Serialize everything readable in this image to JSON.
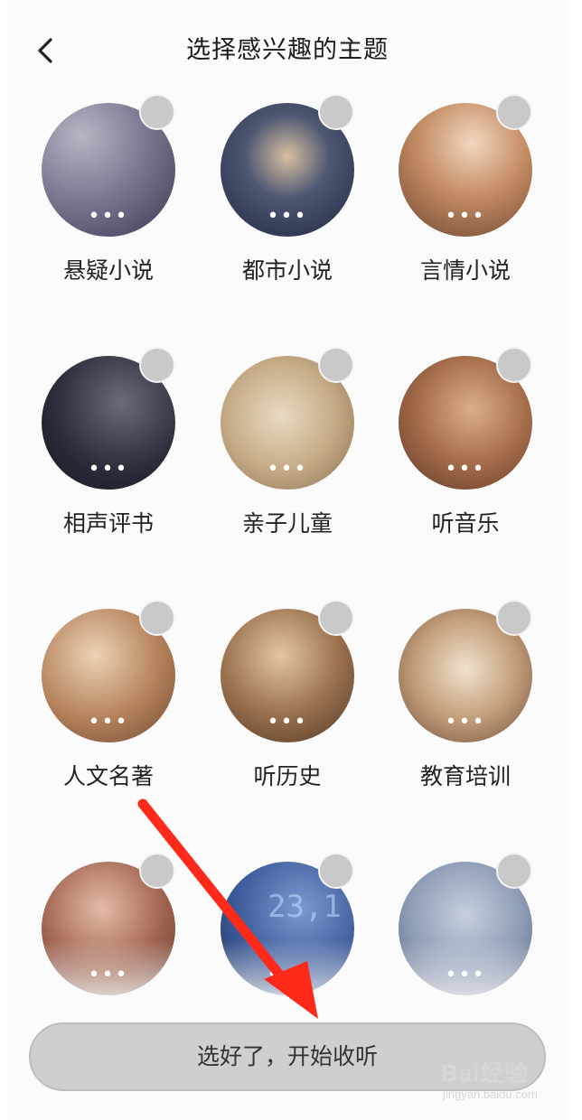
{
  "header": {
    "title": "选择感兴趣的主题",
    "back_icon": "chevron-left-icon"
  },
  "topics": [
    {
      "label": "悬疑小说",
      "more": "•••",
      "bg": "radial-gradient(circle at 30% 25%, #b7b4c4 0%, #7d7a93 45%, #3b3a52 100%)"
    },
    {
      "label": "都市小说",
      "more": "•••",
      "bg": "radial-gradient(circle at 50% 40%, #d8c0a0 0%, #4f5873 40%, #1f2640 100%)"
    },
    {
      "label": "言情小说",
      "more": "•••",
      "bg": "radial-gradient(circle at 55% 30%, #f2d7c0 0%, #c48c63 45%, #6b4530 100%)"
    },
    {
      "label": "相声评书",
      "more": "•••",
      "bg": "radial-gradient(circle at 60% 35%, #6a6d78 0%, #2c2f3c 55%, #14161f 100%)"
    },
    {
      "label": "亲子儿童",
      "more": "•••",
      "bg": "radial-gradient(circle at 45% 45%, #e9dac2 0%, #c7ad88 50%, #8a6e4e 100%)"
    },
    {
      "label": "听音乐",
      "more": "•••",
      "bg": "radial-gradient(circle at 55% 40%, #dcae8a 0%, #a46c4a 50%, #5e3826 100%)"
    },
    {
      "label": "人文名著",
      "more": "•••",
      "bg": "radial-gradient(circle at 40% 35%, #ecd2b4 0%, #b4805a 55%, #6f4a33 100%)"
    },
    {
      "label": "听历史",
      "more": "•••",
      "bg": "radial-gradient(circle at 45% 35%, #e2c6a0 0%, #9e7350 50%, #4f3725 100%)"
    },
    {
      "label": "教育培训",
      "more": "•••",
      "bg": "radial-gradient(circle at 50% 45%, #f0e2cf 0%, #c49f7b 50%, #6f5039 100%)"
    },
    {
      "label": "",
      "more": "•••",
      "bg": "radial-gradient(circle at 45% 35%, #e4bba7 0%, #a0624e 55%, #5b3327 100%)"
    },
    {
      "label": "",
      "more": "•••",
      "bg": "radial-gradient(circle at 60% 35%, #7c9ad0 0%, #3d5b9a 55%, #1b2b55 100%)",
      "overlay_text": "23,1"
    },
    {
      "label": "",
      "more": "•••",
      "bg": "radial-gradient(circle at 50% 40%, #c7cfde 0%, #8d9bb5 55%, #4f5c78 100%)"
    }
  ],
  "action": {
    "label": "选好了，开始收听"
  },
  "watermark": {
    "logo": "Bai经验",
    "sub": "jingyan.baidu.com"
  },
  "colors": {
    "check_circle": "#c9c9c9",
    "button_bg": "#cfcfcf",
    "arrow": "#ff2a1a"
  }
}
